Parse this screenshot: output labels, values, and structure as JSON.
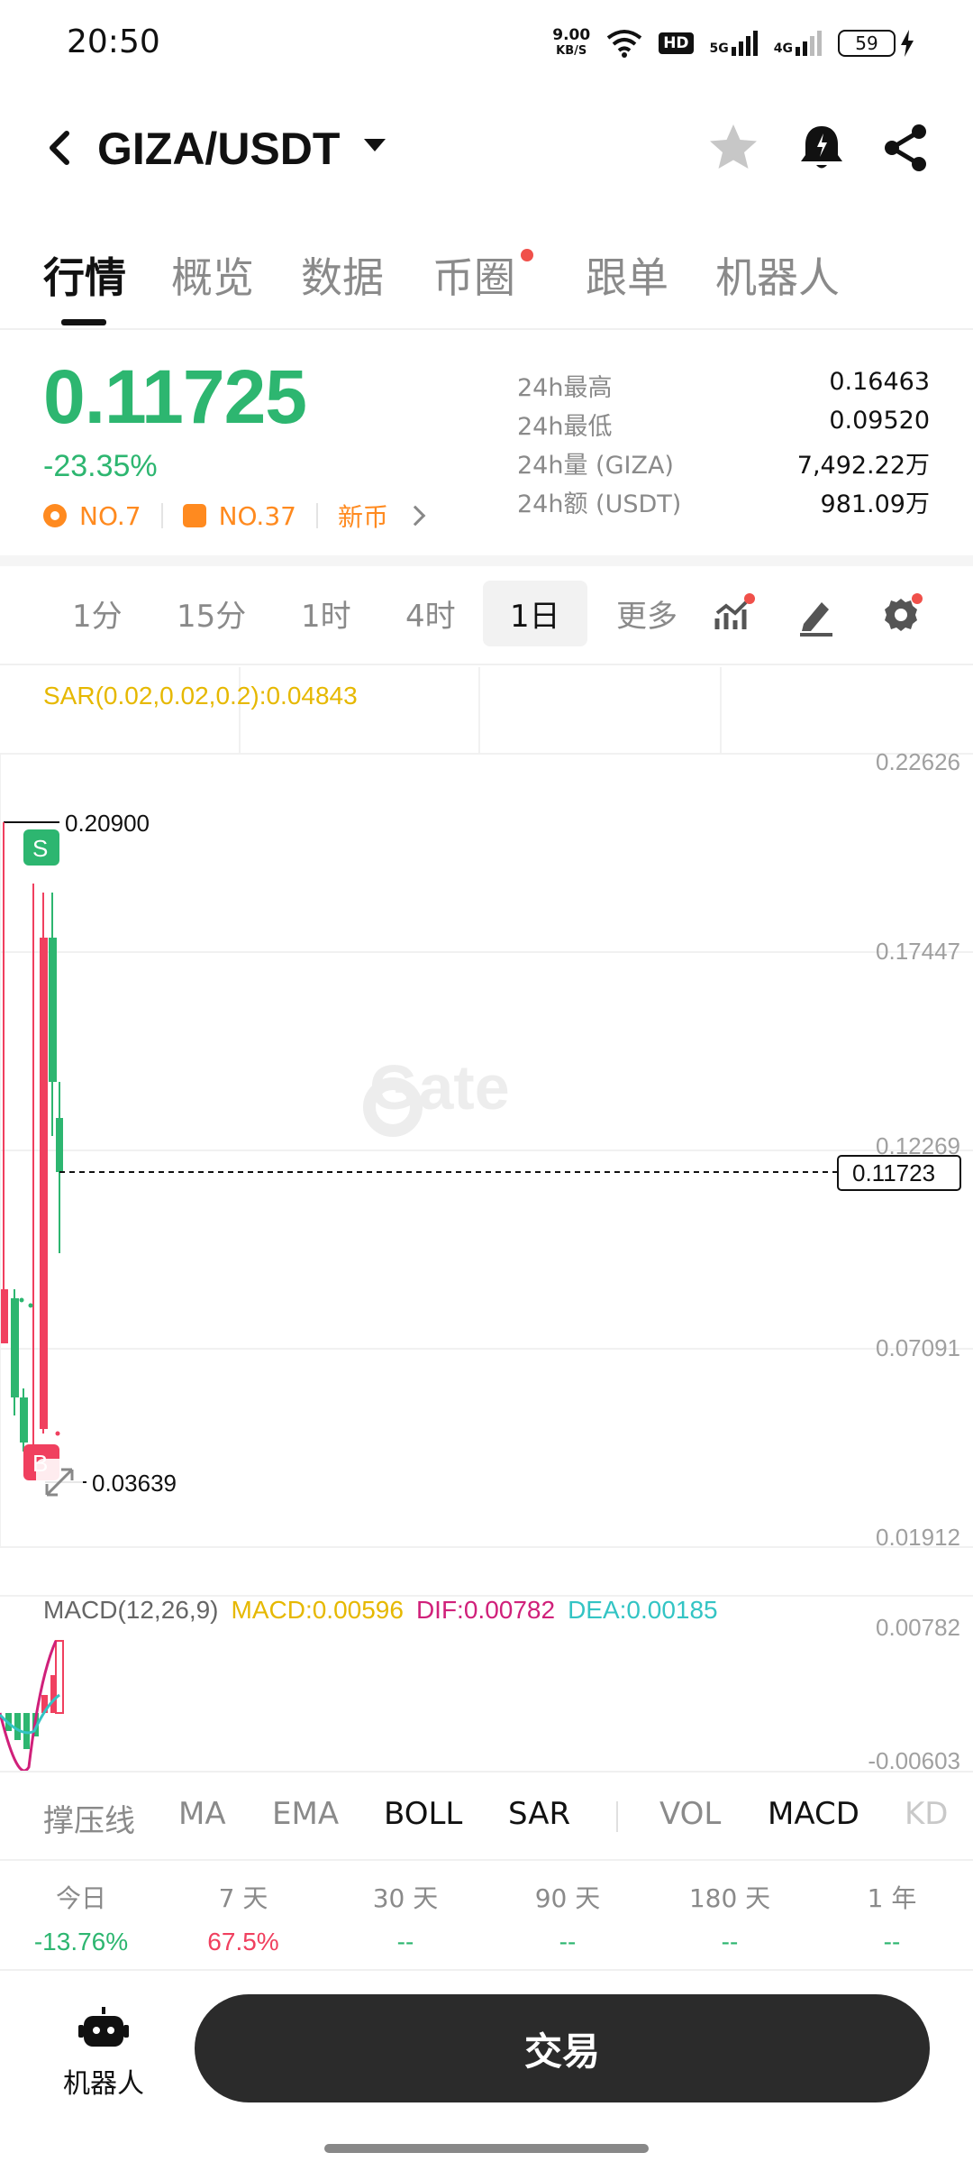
{
  "status_bar": {
    "time": "20:50",
    "net_speed_value": "9.00",
    "net_speed_unit": "KB/S",
    "hd_badge": "HD",
    "sim1_label": "5G",
    "sim2_label": "4G",
    "battery": "59",
    "icons": [
      "wifi-icon",
      "signal-icon",
      "battery-icon",
      "charging-icon"
    ]
  },
  "header": {
    "pair": "GIZA/USDT",
    "icons": [
      "back-icon",
      "star-icon",
      "alert-bell-icon",
      "share-icon"
    ]
  },
  "tabs": [
    {
      "label": "行情",
      "active": true
    },
    {
      "label": "概览",
      "active": false
    },
    {
      "label": "数据",
      "active": false
    },
    {
      "label": "币圈",
      "active": false,
      "dot": true
    },
    {
      "label": "跟单",
      "active": false
    },
    {
      "label": "机器人",
      "active": false
    }
  ],
  "ticker": {
    "last_price": "0.11725",
    "change_pct": "-23.35%",
    "rank1": "NO.7",
    "rank2": "NO.37",
    "tag": "新币",
    "stats": [
      {
        "label": "24h最高",
        "value": "0.16463"
      },
      {
        "label": "24h最低",
        "value": "0.09520"
      },
      {
        "label": "24h量 (GIZA)",
        "value": "7,492.22万"
      },
      {
        "label": "24h额 (USDT)",
        "value": "981.09万"
      }
    ],
    "up_color": "#2db670",
    "down_color": "#f0405f"
  },
  "intervals": {
    "items": [
      "1分",
      "15分",
      "1时",
      "4时",
      "1日"
    ],
    "selected": "1日",
    "more": "更多"
  },
  "chart": {
    "sar_label": "SAR(0.02,0.02,0.2):0.04843",
    "y_axis_labels": [
      "0.22626",
      "0.17447",
      "0.12269",
      "0.07091",
      "0.01912"
    ],
    "current_price_tag": "0.11723",
    "high_marker": "0.20900",
    "low_marker": "0.03639",
    "sell_badge": "S",
    "buy_badge": "B",
    "watermark": "Gate",
    "macd": {
      "name": "MACD(12,26,9)",
      "macd": "MACD:0.00596",
      "dif": "DIF:0.00782",
      "dea": "DEA:0.00185",
      "y_top": "0.00782",
      "y_bottom": "-0.00603"
    }
  },
  "indicators": {
    "main": [
      "撑压线",
      "MA",
      "EMA",
      "BOLL",
      "SAR"
    ],
    "sub": [
      "VOL",
      "MACD",
      "KD"
    ],
    "active": [
      "BOLL",
      "SAR",
      "MACD"
    ]
  },
  "performance": [
    {
      "period": "今日",
      "value": "-13.76%",
      "color": "#2db670"
    },
    {
      "period": "7 天",
      "value": "67.5%",
      "color": "#f0405f"
    },
    {
      "period": "30 天",
      "value": "--",
      "color": "#2db670"
    },
    {
      "period": "90 天",
      "value": "--",
      "color": "#2db670"
    },
    {
      "period": "180 天",
      "value": "--",
      "color": "#2db670"
    },
    {
      "period": "1 年",
      "value": "--",
      "color": "#2db670"
    }
  ],
  "bottom": {
    "robot_label": "机器人",
    "trade_label": "交易"
  }
}
